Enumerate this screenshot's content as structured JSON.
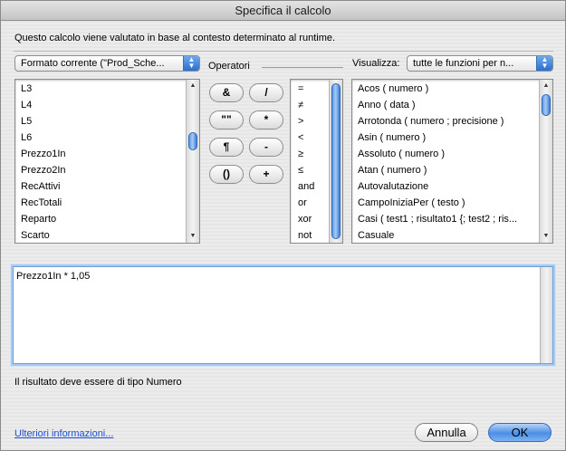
{
  "window": {
    "title": "Specifica il calcolo"
  },
  "description": "Questo calcolo viene valutato in base al contesto determinato al runtime.",
  "context_popup": {
    "value": "Formato corrente (\"Prod_Sche..."
  },
  "operators_label": "Operatori",
  "view_label": "Visualizza:",
  "view_popup": {
    "value": "tutte le funzioni per n..."
  },
  "fields": [
    "L3",
    "L4",
    "L5",
    "L6",
    "Prezzo1In",
    "Prezzo2In",
    "RecAttivi",
    "RecTotali",
    "Reparto",
    "Scarto"
  ],
  "operator_buttons": [
    "&",
    "/",
    "\"\"",
    "*",
    "¶",
    "-",
    "()",
    "+"
  ],
  "comparison_operators": [
    "=",
    "≠",
    ">",
    "<",
    "≥",
    "≤",
    "and",
    "or",
    "xor",
    "not"
  ],
  "functions": [
    "Acos ( numero )",
    "Anno ( data )",
    "Arrotonda ( numero ; precisione )",
    "Asin ( numero )",
    "Assoluto ( numero )",
    "Atan ( numero )",
    "Autovalutazione",
    "CampoIniziaPer ( testo )",
    "Casi ( test1 ; risultato1 {; test2 ; ris...",
    "Casuale"
  ],
  "formula": "Prezzo1In * 1,05",
  "result_type": {
    "prefix": "Il risultato deve essere di tipo",
    "value": "Numero"
  },
  "more_info_link": "Ulteriori informazioni...",
  "buttons": {
    "cancel": "Annulla",
    "ok": "OK"
  },
  "icons": {
    "popup_arrows": "up-down-arrows-icon",
    "scroll_up": "scroll-up-arrow-icon",
    "scroll_down": "scroll-down-arrow-icon"
  },
  "colors": {
    "accent": "#4c8ee6",
    "link": "#1a4fd6"
  }
}
